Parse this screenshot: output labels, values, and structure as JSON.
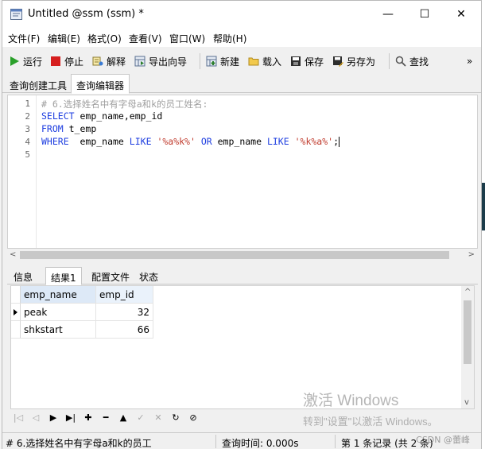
{
  "window": {
    "title": "Untitled @ssm (ssm) *",
    "controls": {
      "minimize": "—",
      "maximize": "☐",
      "close": "✕"
    }
  },
  "menu": [
    "文件(F)",
    "编辑(E)",
    "格式(O)",
    "查看(V)",
    "窗口(W)",
    "帮助(H)"
  ],
  "toolbar": {
    "run": "运行",
    "stop": "停止",
    "explain": "解释",
    "export_wizard": "导出向导",
    "new": "新建",
    "load": "载入",
    "save": "保存",
    "save_as": "另存为",
    "find": "查找",
    "more": "»"
  },
  "top_tabs": {
    "query_builder": "查询创建工具",
    "query_editor": "查询编辑器"
  },
  "editor": {
    "line_numbers": [
      "1",
      "2",
      "3",
      "4",
      "5"
    ],
    "line1": "# 6.选择姓名中有字母a和k的员工姓名:",
    "line2_kw": "SELECT",
    "line2_rest": " emp_name,emp_id",
    "line3_kw": "FROM",
    "line3_rest": " t_emp",
    "line4_kw1": "WHERE",
    "line4_col1": "  emp_name ",
    "line4_kw2": "LIKE",
    "line4_str1": "'%a%k%'",
    "line4_kw3": "OR",
    "line4_col2": " emp_name ",
    "line4_kw4": "LIKE",
    "line4_str2": "'%k%a%'",
    "line4_end": ";"
  },
  "bottom_tabs": {
    "info": "信息",
    "result1": "结果1",
    "profile": "配置文件",
    "status": "状态"
  },
  "result": {
    "columns": [
      "emp_name",
      "emp_id"
    ],
    "rows": [
      {
        "emp_name": "peak",
        "emp_id": "32"
      },
      {
        "emp_name": "shkstart",
        "emp_id": "66"
      }
    ]
  },
  "watermark": {
    "line1": "激活 Windows",
    "line2": "转到\"设置\"以激活 Windows。"
  },
  "statusbar": {
    "query_text": "# 6.选择姓名中有字母a和k的员工",
    "query_time": "查询时间: 0.000s",
    "record_info": "第 1 条记录 (共 2 条)",
    "csdn": "CSDN @蕾峰"
  },
  "colors": {
    "keyword": "#1e3ee0",
    "comment": "#a0a0a0",
    "string": "#c0392b",
    "header_bg": "#eaf2fb"
  }
}
